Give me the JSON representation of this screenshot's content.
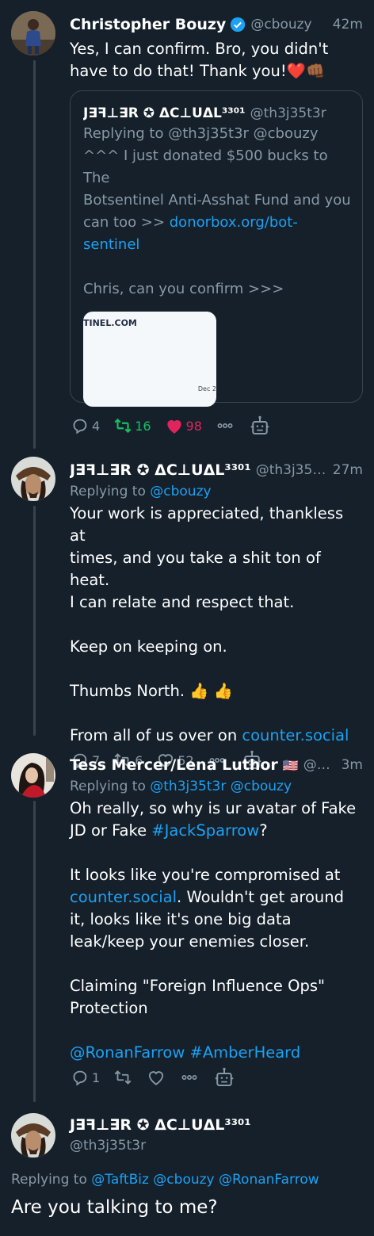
{
  "tweet1": {
    "name": "Christopher Bouzy",
    "handle": "@cbouzy",
    "time": "42m",
    "text_line1": "Yes, I can confirm. Bro, you didn't",
    "text_line2": "have to do that! Thank you!",
    "emoji": "❤️👊🏾",
    "quote": {
      "name": "J∃ꟻ⊥∃R ✪ ΔC⊥UΔL³³⁰¹",
      "handle": "@th3j35t3r",
      "reply_to": "Replying to @th3j35t3r @cbouzy",
      "line1": "^^^ I just donated $500 bucks to The",
      "line2": "Botsentinel Anti-Asshat Fund and you",
      "line3_prefix": "can too >> ",
      "link_part1": "donorbox.org/bot-",
      "link_part2": "sentinel",
      "line5": "Chris, can you confirm >>>",
      "card_text": "TINEL.COM",
      "card_date": "Dec 2"
    },
    "replies": "4",
    "retweets": "16",
    "likes": "98"
  },
  "tweet2": {
    "name": "J∃ꟻ⊥∃R ✪ ΔC⊥UΔL³³⁰¹",
    "handle": "@th3j35t3r",
    "time": "27m",
    "reply_prefix": "Replying to ",
    "reply_link": "@cbouzy",
    "line1": "Your work is appreciated, thankless at",
    "line2": "times, and you take a shit ton of heat.",
    "line3": "I can relate and respect that.",
    "line4": "Keep on keeping on.",
    "line5": "Thumbs North. 👍 👍",
    "line6_prefix": "From all of us over on ",
    "line6_link": "counter.social",
    "replies": "7",
    "retweets": "6",
    "likes": "52"
  },
  "tweet3": {
    "name": "Tess Mercer/Lena Luthor",
    "flag": "🇺🇸",
    "handle": "@T...",
    "time": "3m",
    "reply_prefix": "Replying to ",
    "reply_links": "@th3j35t3r @cbouzy",
    "line1": "Oh really, so why is ur avatar of Fake",
    "line2_prefix": "JD or Fake ",
    "line2_link": "#JackSparrow",
    "line2_suffix": "?",
    "line3": "It looks like you're compromised at",
    "line4_link": "counter.social",
    "line4_suffix": ". Wouldn't get around",
    "line5": "it, looks like it's one big data",
    "line6": "leak/keep your enemies closer.",
    "line7": "Claiming \"Foreign Influence Ops\"",
    "line8": "Protection",
    "line9_link1": "@RonanFarrow",
    "line9_link2": "#AmberHeard",
    "replies": "1"
  },
  "main": {
    "name": "J∃ꟻ⊥∃R ✪ ΔC⊥UΔL³³⁰¹",
    "handle": "@th3j35t3r",
    "reply_prefix": "Replying to ",
    "reply_links": "@TaftBiz @cbouzy @RonanFarrow",
    "text": "Are you talking to me?"
  },
  "colors": {
    "background": "#15202b",
    "link": "#1da1f2",
    "secondary_text": "#8899a6",
    "retweet_green": "#17bf63",
    "like_red": "#e0245e",
    "border": "#38444d"
  }
}
